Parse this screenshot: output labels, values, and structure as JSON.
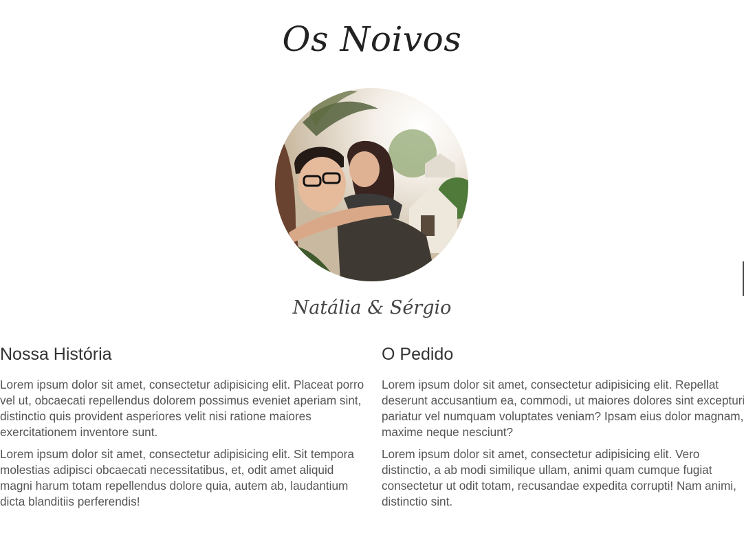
{
  "page": {
    "title": "Os Noivos",
    "couple_names": "Natália & Sérgio",
    "photo_icon": "couple-photo"
  },
  "stories": [
    {
      "heading": "Nossa História",
      "paragraphs": [
        "Lorem ipsum dolor sit amet, consectetur adipisicing elit. Placeat porro vel ut, obcaecati repellendus dolorem possimus eveniet aperiam sint, distinctio quis provident asperiores velit nisi ratione maiores exercitationem inventore sunt.",
        "Lorem ipsum dolor sit amet, consectetur adipisicing elit. Sit tempora molestias adipisci obcaecati necessitatibus, et, odit amet aliquid magni harum totam repellendus dolore quia, autem ab, laudantium dicta blanditiis perferendis!"
      ]
    },
    {
      "heading": "O Pedido",
      "paragraphs": [
        "Lorem ipsum dolor sit amet, consectetur adipisicing elit. Repellat deserunt accusantium ea, commodi, ut maiores dolores sint excepturi pariatur vel numquam voluptates veniam? Ipsam eius dolor magnam, maxime neque nesciunt?",
        "Lorem ipsum dolor sit amet, consectetur adipisicing elit. Vero distinctio, a ab modi similique ullam, animi quam cumque fugiat consectetur ut odit totam, recusandae expedita corrupti! Nam animi, distinctio sint."
      ]
    }
  ],
  "colors": {
    "title": "#222222",
    "text": "#555555",
    "heading": "#333333"
  }
}
